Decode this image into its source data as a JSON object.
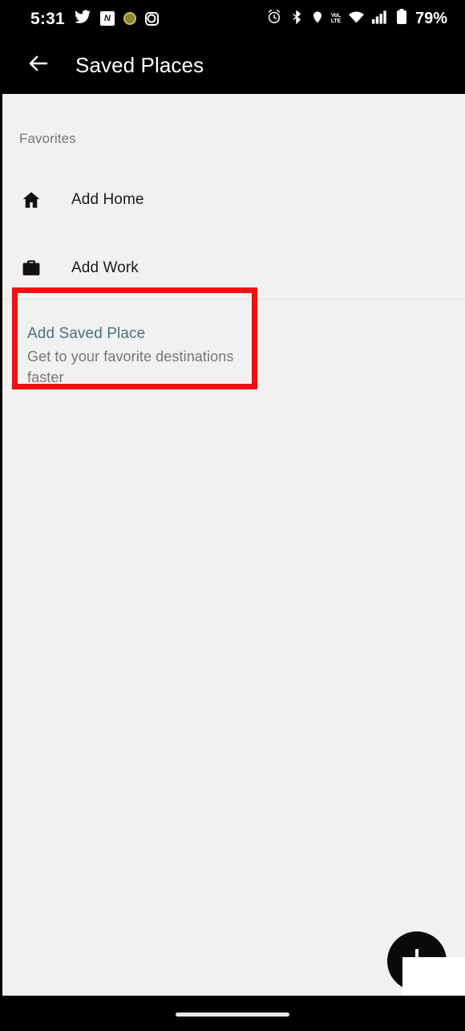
{
  "status_bar": {
    "time": "5:31",
    "battery_percent": "79%",
    "volte_top": "VoL",
    "volte_bottom": "LTE",
    "n_badge": "N",
    "left_icons": [
      "twitter-icon",
      "news-n-icon",
      "gold-circle-icon",
      "instagram-icon"
    ],
    "right_icons": [
      "alarm-icon",
      "bluetooth-icon",
      "location-icon",
      "volte-icon",
      "wifi-icon",
      "signal-icon",
      "battery-icon"
    ]
  },
  "app_bar": {
    "back_icon": "arrow-left-icon",
    "title": "Saved Places"
  },
  "content": {
    "section_label": "Favorites",
    "rows": [
      {
        "icon": "home-icon",
        "label": "Add Home"
      },
      {
        "icon": "briefcase-icon",
        "label": "Add Work"
      }
    ],
    "saved_place": {
      "title": "Add Saved Place",
      "subtitle": "Get to your favorite destinations faster",
      "highlight_color": "#ef1111",
      "title_color": "#4a7282"
    }
  },
  "fab": {
    "icon": "plus-icon",
    "background_color": "#0a0a0a"
  },
  "nav_bar": {
    "gesture_pill": "home-gesture-pill"
  },
  "colors": {
    "status_bar_bg": "#000000",
    "content_bg": "#f1f1f1",
    "primary_text": "#1a1a1a",
    "secondary_text": "#767676",
    "divider": "#e2e2e2"
  }
}
